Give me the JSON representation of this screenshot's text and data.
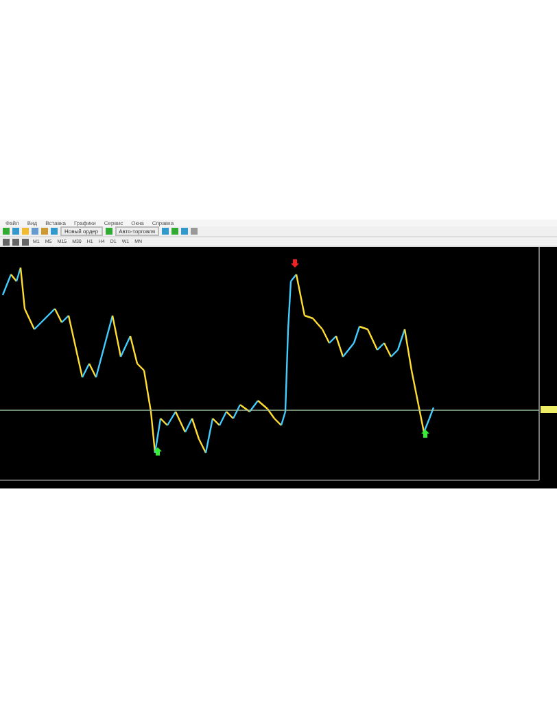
{
  "menu": [
    "Файл",
    "Вид",
    "Вставка",
    "Графики",
    "Сервис",
    "Окна",
    "Справка"
  ],
  "toolbar": {
    "buttons": [
      "Новый ордер",
      "Авто-торговля"
    ]
  },
  "timeframes": [
    {
      "label": "M1",
      "selected": false
    },
    {
      "label": "M5",
      "selected": false
    },
    {
      "label": "M15",
      "selected": false
    },
    {
      "label": "M30",
      "selected": false
    },
    {
      "label": "H1",
      "selected": false
    },
    {
      "label": "H4",
      "selected": false
    },
    {
      "label": "D1",
      "selected": false
    },
    {
      "label": "W1",
      "selected": false
    },
    {
      "label": "MN",
      "selected": false
    }
  ]
}
